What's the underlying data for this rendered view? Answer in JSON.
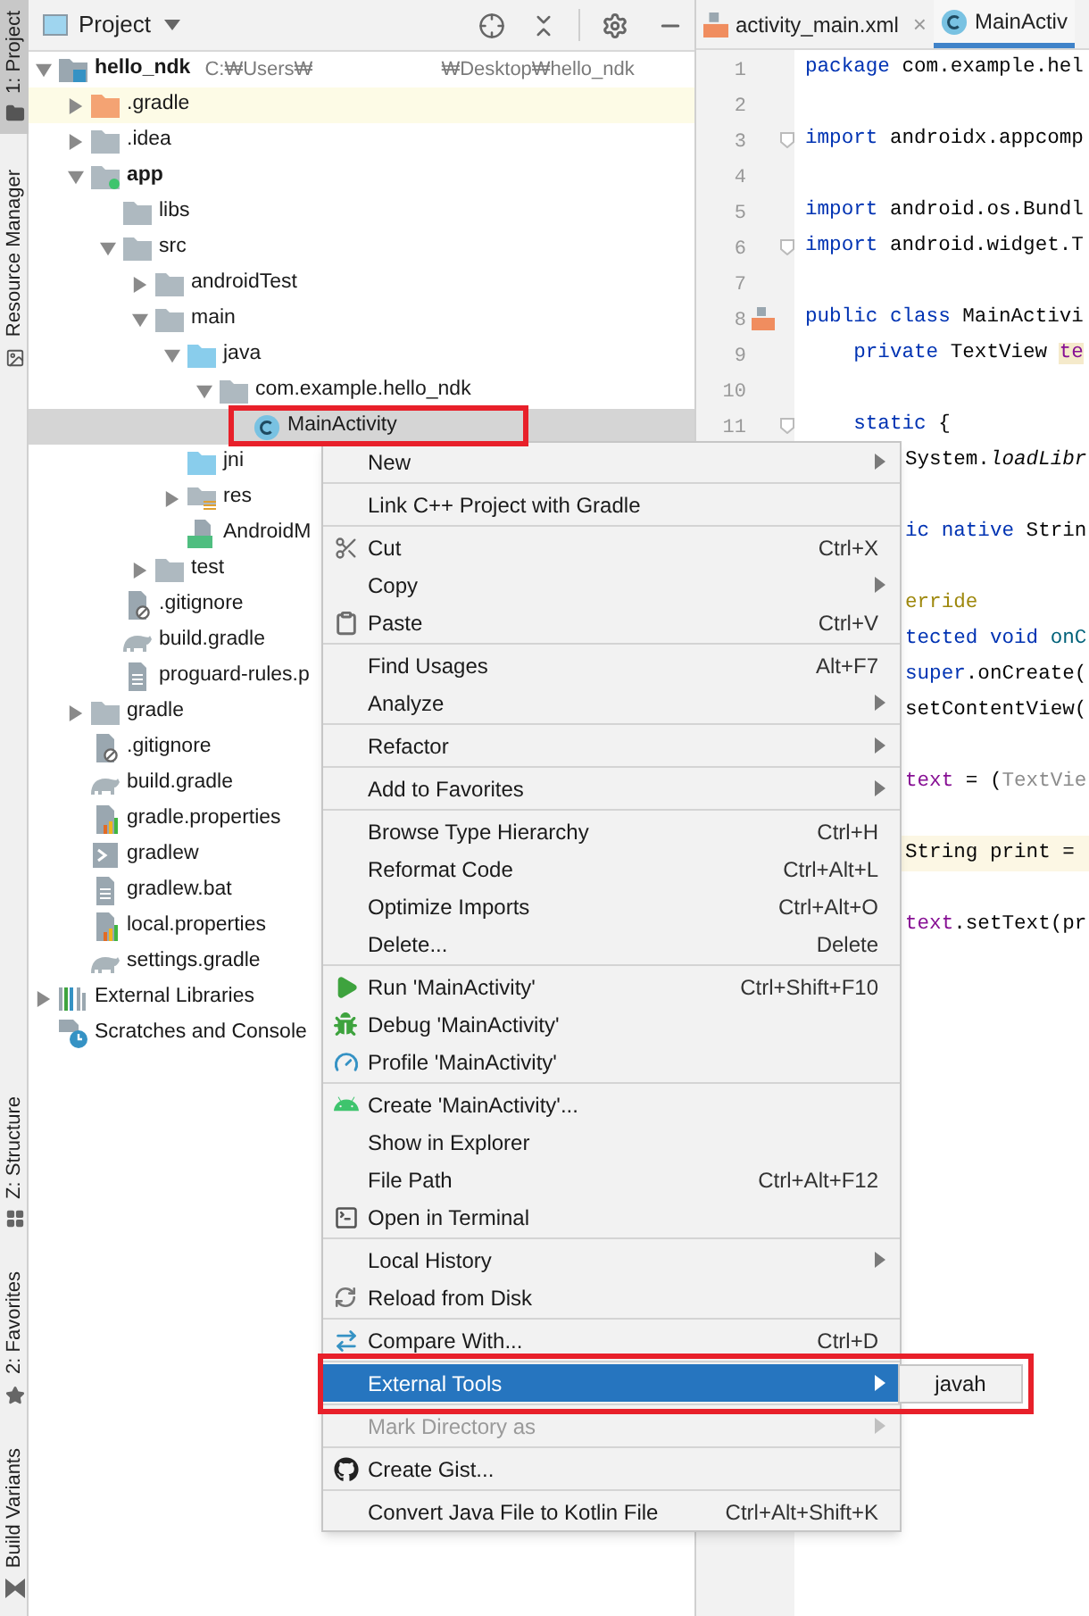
{
  "tool_strip": {
    "top": [
      {
        "label": "1: Project",
        "kind": "project",
        "selected": true
      },
      {
        "label": "Resource Manager",
        "kind": "resources",
        "selected": false
      }
    ],
    "bottom": [
      {
        "label": "Z: Structure",
        "kind": "structure",
        "selected": false
      },
      {
        "label": "2: Favorites",
        "kind": "favorites",
        "selected": false
      },
      {
        "label": "Build Variants",
        "kind": "variants",
        "selected": false
      }
    ]
  },
  "project_panel": {
    "title": "Project",
    "tree": [
      {
        "label": "hello_ndk",
        "kind": "project",
        "path": [
          "C:₩Users₩",
          "₩Desktop₩hello_ndk"
        ],
        "expanded": true,
        "selected": false,
        "children": [
          {
            "label": ".gradle",
            "kind": "excluded",
            "expanded": false,
            "selected": false
          },
          {
            "label": ".idea",
            "kind": "folder",
            "expanded": false,
            "selected": false
          },
          {
            "label": "app",
            "kind": "module",
            "expanded": true,
            "selected": false,
            "children": [
              {
                "label": "libs",
                "kind": "folder",
                "selected": false
              },
              {
                "label": "src",
                "kind": "folder",
                "expanded": true,
                "selected": false,
                "children": [
                  {
                    "label": "androidTest",
                    "kind": "folder",
                    "expanded": false,
                    "selected": false
                  },
                  {
                    "label": "main",
                    "kind": "folder",
                    "expanded": true,
                    "selected": false,
                    "children": [
                      {
                        "label": "java",
                        "kind": "source",
                        "expanded": true,
                        "selected": false,
                        "children": [
                          {
                            "label": "com.example.hello_ndk",
                            "kind": "package",
                            "expanded": true,
                            "selected": false,
                            "children": [
                              {
                                "label": "MainActivity",
                                "kind": "class",
                                "selected": true,
                                "framed": true
                              }
                            ]
                          }
                        ]
                      },
                      {
                        "label": "jni",
                        "kind": "source",
                        "selected": false
                      },
                      {
                        "label": "res",
                        "kind": "resources",
                        "expanded": false,
                        "selected": false
                      },
                      {
                        "label": "AndroidM",
                        "kind": "manifest",
                        "selected": false
                      }
                    ]
                  },
                  {
                    "label": "test",
                    "kind": "folder",
                    "expanded": false,
                    "selected": false
                  }
                ]
              },
              {
                "label": ".gitignore",
                "kind": "ignore",
                "selected": false
              },
              {
                "label": "build.gradle",
                "kind": "gradle",
                "selected": false
              },
              {
                "label": "proguard-rules.p",
                "kind": "text",
                "selected": false
              }
            ]
          },
          {
            "label": "gradle",
            "kind": "folder",
            "expanded": false,
            "selected": false
          },
          {
            "label": ".gitignore",
            "kind": "ignore",
            "selected": false
          },
          {
            "label": "build.gradle",
            "kind": "gradle",
            "selected": false
          },
          {
            "label": "gradle.properties",
            "kind": "properties",
            "selected": false
          },
          {
            "label": "gradlew",
            "kind": "script",
            "selected": false
          },
          {
            "label": "gradlew.bat",
            "kind": "text",
            "selected": false
          },
          {
            "label": "local.properties",
            "kind": "properties",
            "selected": false
          },
          {
            "label": "settings.gradle",
            "kind": "gradle",
            "selected": false
          }
        ]
      },
      {
        "label": "External Libraries",
        "kind": "libraries",
        "expanded": false,
        "selected": false
      },
      {
        "label": "Scratches and Console",
        "kind": "scratches",
        "selected": false
      }
    ]
  },
  "editor": {
    "tabs": [
      {
        "label": "activity_main.xml",
        "kind": "xml",
        "close": "×",
        "selected": false
      },
      {
        "label": "MainActiv",
        "kind": "class",
        "selected": true
      }
    ],
    "lines": [
      {
        "number": "1",
        "kind": "full",
        "segments": [
          {
            "text": "package",
            "kind": "keyword"
          },
          {
            "text": " com.example.hel",
            "kind": "plain"
          }
        ]
      },
      {
        "number": "2",
        "kind": "full"
      },
      {
        "number": "3",
        "kind": "full",
        "fold": true,
        "segments": [
          {
            "text": "import",
            "kind": "keyword"
          },
          {
            "text": " androidx.appcomp",
            "kind": "plain"
          }
        ]
      },
      {
        "number": "4",
        "kind": "full"
      },
      {
        "number": "5",
        "kind": "full",
        "segments": [
          {
            "text": "import",
            "kind": "keyword"
          },
          {
            "text": " android.os.Bundl",
            "kind": "plain"
          }
        ]
      },
      {
        "number": "6",
        "kind": "full",
        "fold": true,
        "segments": [
          {
            "text": "import",
            "kind": "keyword"
          },
          {
            "text": " android.widget.T",
            "kind": "plain"
          }
        ]
      },
      {
        "number": "7",
        "kind": "full"
      },
      {
        "number": "8",
        "kind": "full",
        "gutter_icon": true,
        "segments": [
          {
            "text": "public class",
            "kind": "keyword"
          },
          {
            "text": " MainActivi",
            "kind": "plain"
          }
        ]
      },
      {
        "number": "9",
        "kind": "full",
        "segments": [
          {
            "text": "    private",
            "kind": "keyword"
          },
          {
            "text": " TextView ",
            "kind": "plain"
          },
          {
            "text": "te",
            "kind": "marked"
          }
        ]
      },
      {
        "number": "10",
        "kind": "full"
      },
      {
        "number": "11",
        "kind": "full",
        "fold": true,
        "segments": [
          {
            "text": "    static",
            "kind": "keyword"
          },
          {
            "text": " {",
            "kind": "plain"
          }
        ]
      },
      {
        "kind": "clipped",
        "segments": [
          {
            "text": "System.",
            "kind": "plain"
          },
          {
            "text": "loadLibr",
            "kind": "italic"
          }
        ]
      },
      {
        "kind": "blank"
      },
      {
        "kind": "clipped",
        "segments": [
          {
            "text": "ic native",
            "kind": "keyword"
          },
          {
            "text": " Strin",
            "kind": "plain"
          }
        ]
      },
      {
        "kind": "blank"
      },
      {
        "kind": "clipped",
        "segments": [
          {
            "text": "erride",
            "kind": "annotation"
          }
        ]
      },
      {
        "kind": "clipped",
        "segments": [
          {
            "text": "tected void",
            "kind": "keyword"
          },
          {
            "text": " onC",
            "kind": "method"
          }
        ]
      },
      {
        "kind": "clipped",
        "segments": [
          {
            "text": "super",
            "kind": "keyword"
          },
          {
            "text": ".onCreate(",
            "kind": "plain"
          }
        ]
      },
      {
        "kind": "clipped",
        "segments": [
          {
            "text": "setContentView(",
            "kind": "plain"
          }
        ]
      },
      {
        "kind": "blank"
      },
      {
        "kind": "clipped",
        "segments": [
          {
            "text": "text",
            "kind": "field"
          },
          {
            "text": " = (",
            "kind": "plain"
          },
          {
            "text": "TextVie",
            "kind": "muted"
          }
        ]
      },
      {
        "kind": "blank"
      },
      {
        "kind": "clipped",
        "highlighted": true,
        "segments": [
          {
            "text": "String print =",
            "kind": "plain"
          }
        ]
      },
      {
        "kind": "blank"
      },
      {
        "kind": "clipped",
        "segments": [
          {
            "text": "text",
            "kind": "field"
          },
          {
            "text": ".setText(pr",
            "kind": "plain"
          }
        ]
      }
    ]
  },
  "context_menu": {
    "groups": [
      [
        {
          "label": "New",
          "submenu": true,
          "disabled": false,
          "selected": false
        }
      ],
      [
        {
          "label": "Link C++ Project with Gradle",
          "submenu": false,
          "disabled": false,
          "selected": false
        }
      ],
      [
        {
          "label": "Cut",
          "shortcut": "Ctrl+X",
          "submenu": false,
          "disabled": false,
          "selected": false
        },
        {
          "label": "Copy",
          "submenu": true,
          "disabled": false,
          "selected": false
        },
        {
          "label": "Paste",
          "shortcut": "Ctrl+V",
          "submenu": false,
          "disabled": false,
          "selected": false
        }
      ],
      [
        {
          "label": "Find Usages",
          "shortcut": "Alt+F7",
          "submenu": false,
          "disabled": false,
          "selected": false
        },
        {
          "label": "Analyze",
          "submenu": true,
          "disabled": false,
          "selected": false
        }
      ],
      [
        {
          "label": "Refactor",
          "submenu": true,
          "disabled": false,
          "selected": false
        }
      ],
      [
        {
          "label": "Add to Favorites",
          "submenu": true,
          "disabled": false,
          "selected": false
        }
      ],
      [
        {
          "label": "Browse Type Hierarchy",
          "shortcut": "Ctrl+H",
          "submenu": false,
          "disabled": false,
          "selected": false
        },
        {
          "label": "Reformat Code",
          "shortcut": "Ctrl+Alt+L",
          "submenu": false,
          "disabled": false,
          "selected": false
        },
        {
          "label": "Optimize Imports",
          "shortcut": "Ctrl+Alt+O",
          "submenu": false,
          "disabled": false,
          "selected": false
        },
        {
          "label": "Delete...",
          "shortcut": "Delete",
          "submenu": false,
          "disabled": false,
          "selected": false
        }
      ],
      [
        {
          "label": "Run 'MainActivity'",
          "shortcut": "Ctrl+Shift+F10",
          "submenu": false,
          "disabled": false,
          "selected": false
        },
        {
          "label": "Debug 'MainActivity'",
          "submenu": false,
          "disabled": false,
          "selected": false
        },
        {
          "label": "Profile 'MainActivity'",
          "submenu": false,
          "disabled": false,
          "selected": false
        }
      ],
      [
        {
          "label": "Create 'MainActivity'...",
          "submenu": false,
          "disabled": false,
          "selected": false
        },
        {
          "label": "Show in Explorer",
          "submenu": false,
          "disabled": false,
          "selected": false
        },
        {
          "label": "File Path",
          "shortcut": "Ctrl+Alt+F12",
          "submenu": false,
          "disabled": false,
          "selected": false
        },
        {
          "label": "Open in Terminal",
          "submenu": false,
          "disabled": false,
          "selected": false
        }
      ],
      [
        {
          "label": "Local History",
          "submenu": true,
          "disabled": false,
          "selected": false
        },
        {
          "label": "Reload from Disk",
          "submenu": false,
          "disabled": false,
          "selected": false
        }
      ],
      [
        {
          "label": "Compare With...",
          "shortcut": "Ctrl+D",
          "submenu": false,
          "disabled": false,
          "selected": false
        }
      ],
      [
        {
          "label": "External Tools",
          "submenu": true,
          "disabled": false,
          "selected": true,
          "framed": true,
          "submenu_items": [
            {
              "label": "javah"
            }
          ]
        }
      ],
      [
        {
          "label": "Mark Directory as",
          "submenu": true,
          "disabled": true,
          "selected": false
        }
      ],
      [
        {
          "label": "Create Gist...",
          "submenu": false,
          "disabled": false,
          "selected": false
        }
      ],
      [
        {
          "label": "Convert Java File to Kotlin File",
          "shortcut": "Ctrl+Alt+Shift+K",
          "submenu": false,
          "disabled": false,
          "selected": false
        }
      ]
    ]
  }
}
